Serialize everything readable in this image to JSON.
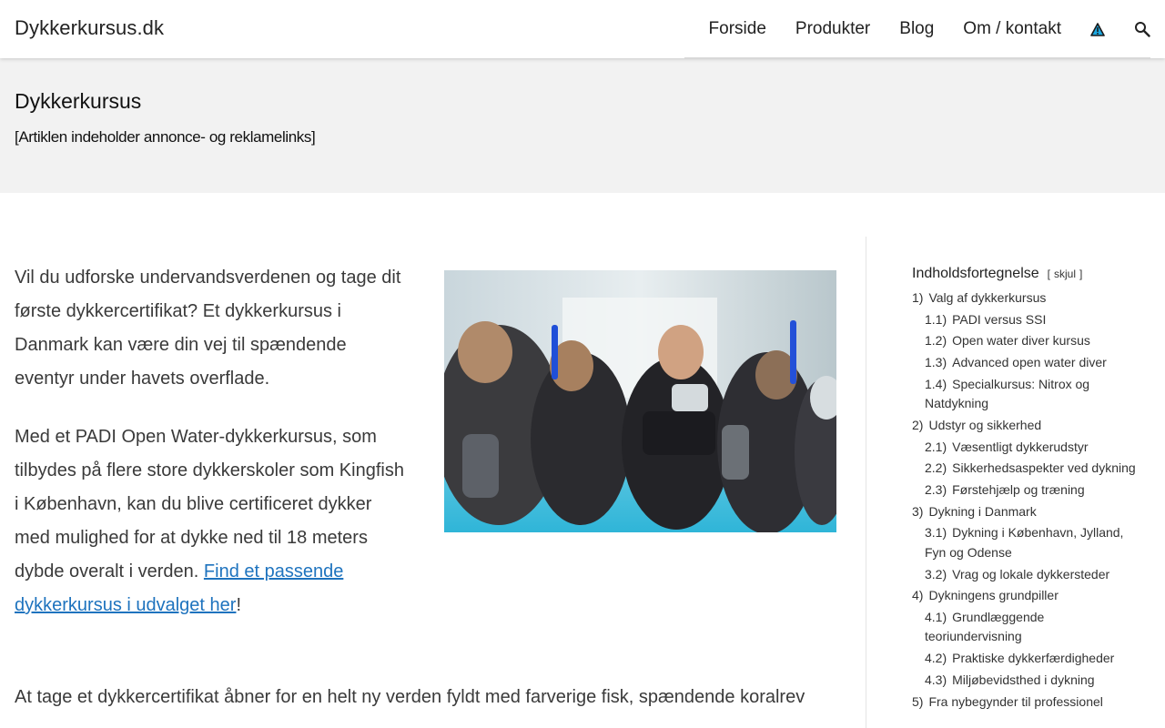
{
  "header": {
    "site_title": "Dykkerkursus.dk",
    "nav": [
      "Forside",
      "Produkter",
      "Blog",
      "Om / kontakt"
    ],
    "icons": [
      "warning-triangle-icon",
      "search-icon"
    ],
    "colors": {
      "warning_fill": "#1ba7e0",
      "warning_stroke": "#1a1a1a"
    }
  },
  "page": {
    "title": "Dykkerkursus",
    "note": "[Artiklen indeholder annonce- og reklamelinks]"
  },
  "article": {
    "p1": "Vil du udforske undervandsverdenen og tage dit første dykkercertifikat? Et dykkerkursus i Danmark kan være din vej til spændende eventyr under havets overflade.",
    "p2_text": "Med et PADI Open Water-dykkerkursus, som tilbydes på flere store dykkerskoler som Kingfish i København, kan du blive certificeret dykker med mulighed for at dykke ned til 18 meters dybde overalt i verden. ",
    "p2_link": "Find et passende dykkerkursus i udvalget her",
    "p2_end": "!",
    "p3": "At tage et dykkercertifikat åbner for en helt ny verden fyldt med farverige fisk, spændende koralrev",
    "link_color": "#1e73be"
  },
  "toc": {
    "title": "Indholdsfortegnelse",
    "toggle_open": "[",
    "toggle_label": "skjul",
    "toggle_close": "]",
    "items": [
      {
        "num": "1)",
        "label": "Valg af dykkerkursus",
        "level": 1
      },
      {
        "num": "1.1)",
        "label": "PADI versus SSI",
        "level": 2
      },
      {
        "num": "1.2)",
        "label": "Open water diver kursus",
        "level": 2
      },
      {
        "num": "1.3)",
        "label": "Advanced open water diver",
        "level": 2
      },
      {
        "num": "1.4)",
        "label": "Specialkursus: Nitrox og Natdykning",
        "level": 2
      },
      {
        "num": "2)",
        "label": "Udstyr og sikkerhed",
        "level": 1
      },
      {
        "num": "2.1)",
        "label": "Væsentligt dykkerudstyr",
        "level": 2
      },
      {
        "num": "2.2)",
        "label": "Sikkerhedsaspekter ved dykning",
        "level": 2
      },
      {
        "num": "2.3)",
        "label": "Førstehjælp og træning",
        "level": 2
      },
      {
        "num": "3)",
        "label": "Dykning i Danmark",
        "level": 1
      },
      {
        "num": "3.1)",
        "label": "Dykning i København, Jylland, Fyn og Odense",
        "level": 2
      },
      {
        "num": "3.2)",
        "label": "Vrag og lokale dykkersteder",
        "level": 2
      },
      {
        "num": "4)",
        "label": "Dykningens grundpiller",
        "level": 1
      },
      {
        "num": "4.1)",
        "label": "Grundlæggende teoriundervisning",
        "level": 2
      },
      {
        "num": "4.2)",
        "label": "Praktiske dykkerfærdigheder",
        "level": 2
      },
      {
        "num": "4.3)",
        "label": "Miljøbevidsthed i dykning",
        "level": 2
      },
      {
        "num": "5)",
        "label": "Fra nybegynder til professionel",
        "level": 1
      }
    ]
  }
}
